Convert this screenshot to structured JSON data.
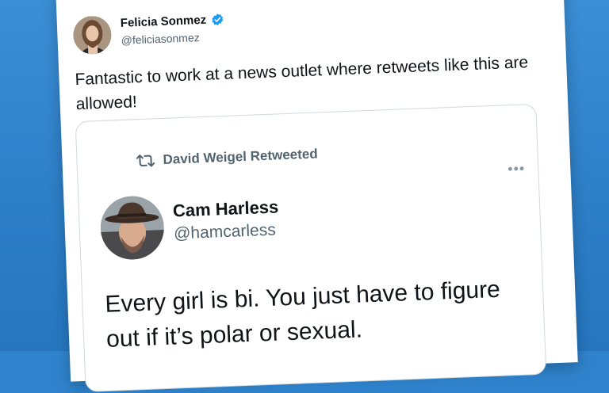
{
  "author": {
    "display_name": "Felicia Sonmez",
    "handle": "@feliciasonmez",
    "verified": true,
    "avatar_icon": "avatar-photo-icon"
  },
  "tweet": {
    "text": "Fantastic to work at a news outlet where retweets like this are allowed!",
    "more_label": "•••"
  },
  "quoted": {
    "retweet_label": "David Weigel Retweeted",
    "retweet_icon": "retweet-icon",
    "more_label": "•••",
    "display_name": "Cam Harless",
    "handle": "@hamcarless",
    "avatar_icon": "avatar-photo-icon",
    "text": "Every girl is bi. You just have to figure out if it’s polar or sexual."
  },
  "colors": {
    "background": "#2f83cc",
    "verified_badge": "#1d9bf0",
    "muted_text": "#536471"
  }
}
